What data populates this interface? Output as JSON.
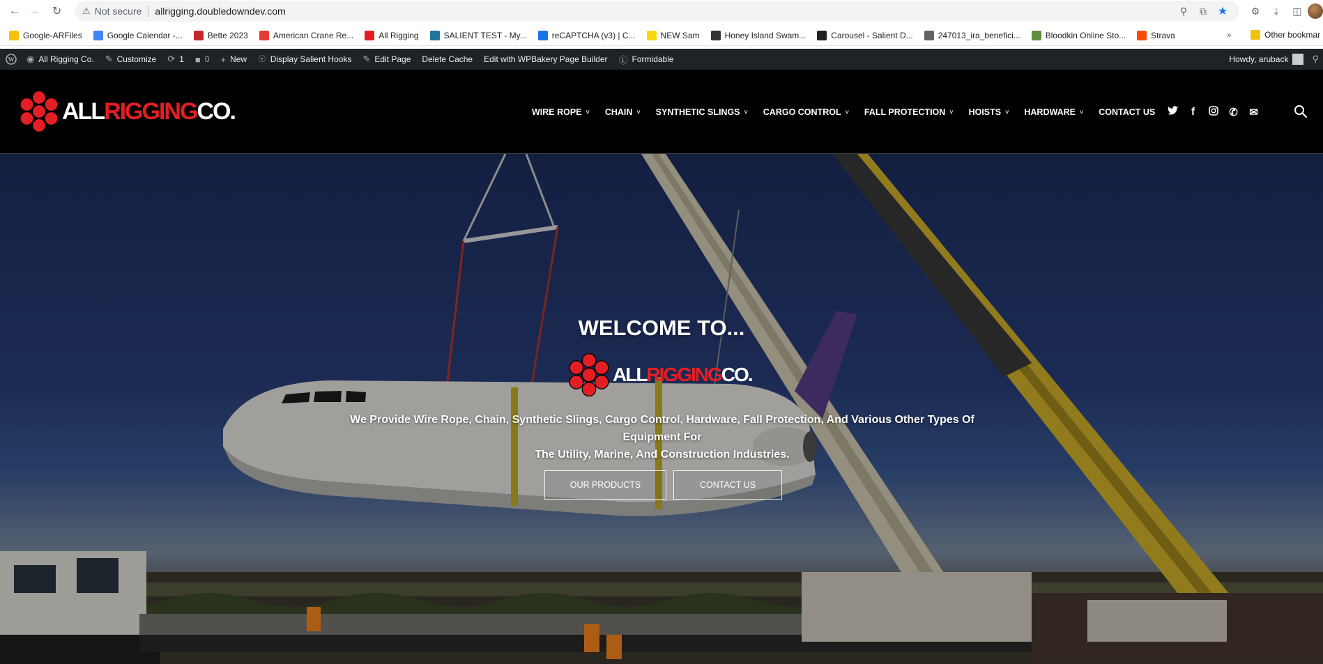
{
  "browser": {
    "security_label": "Not secure",
    "url": "allrigging.doubledowndev.com"
  },
  "bookmarks": {
    "items": [
      {
        "label": "Google-ARFiles",
        "icon": "folder-icon",
        "color": "#f4c20d"
      },
      {
        "label": "Google Calendar -...",
        "icon": "calendar-icon",
        "color": "#4285f4"
      },
      {
        "label": "Bette 2023",
        "icon": "j-icon",
        "color": "#c62828"
      },
      {
        "label": "American Crane Re...",
        "icon": "crane-icon",
        "color": "#e53935"
      },
      {
        "label": "All Rigging",
        "icon": "allrigging-icon",
        "color": "#e31e24"
      },
      {
        "label": "SALIENT TEST - My...",
        "icon": "wordpress-icon",
        "color": "#21759b"
      },
      {
        "label": "reCAPTCHA (v3) | C...",
        "icon": "recaptcha-icon",
        "color": "#1a73e8"
      },
      {
        "label": "NEW Sam",
        "icon": "s-icon",
        "color": "#f5d90a"
      },
      {
        "label": "Honey Island Swam...",
        "icon": "honey-icon",
        "color": "#333333"
      },
      {
        "label": "Carousel - Salient D...",
        "icon": "salient-icon",
        "color": "#222222"
      },
      {
        "label": "247013_ira_benefici...",
        "icon": "globe-icon",
        "color": "#5f6368"
      },
      {
        "label": "Bloodkin Online Sto...",
        "icon": "shopify-icon",
        "color": "#5e8e3e"
      },
      {
        "label": "Strava",
        "icon": "strava-icon",
        "color": "#fc4c02"
      }
    ],
    "more": "»",
    "other_label": "Other bookmar"
  },
  "wp_admin": {
    "site_name": "All Rigging Co.",
    "customize": "Customize",
    "updates": "1",
    "comments": "0",
    "new": "New",
    "display_hooks": "Display Salient Hooks",
    "edit_page": "Edit Page",
    "delete_cache": "Delete Cache",
    "wpbakery": "Edit with WPBakery Page Builder",
    "formidable": "Formidable",
    "howdy": "Howdy, aruback"
  },
  "site": {
    "logo": {
      "part1": "ALL",
      "part2": "RIGGING",
      "part3": "CO."
    },
    "menu": [
      {
        "label": "WIRE ROPE",
        "caret": true
      },
      {
        "label": "CHAIN",
        "caret": true
      },
      {
        "label": "SYNTHETIC SLINGS",
        "caret": true
      },
      {
        "label": "CARGO CONTROL",
        "caret": true
      },
      {
        "label": "FALL PROTECTION",
        "caret": true
      },
      {
        "label": "HOISTS",
        "caret": true
      },
      {
        "label": "HARDWARE",
        "caret": true
      },
      {
        "label": "CONTACT US",
        "caret": false
      }
    ],
    "social_icons": [
      "twitter-icon",
      "facebook-icon",
      "instagram-icon",
      "phone-icon",
      "email-icon"
    ]
  },
  "hero": {
    "title": "WELCOME TO...",
    "description_line1": "We Provide Wire Rope, Chain, Synthetic Slings, Cargo Control, Hardware, Fall Protection, And Various Other Types Of Equipment For",
    "description_line2": "The Utility, Marine, And Construction Industries.",
    "btn_products": "OUR PRODUCTS",
    "btn_contact": "CONTACT US"
  },
  "colors": {
    "brand_red": "#e31e24",
    "header_bg": "#000000",
    "wp_bar_bg": "#1d2327"
  }
}
